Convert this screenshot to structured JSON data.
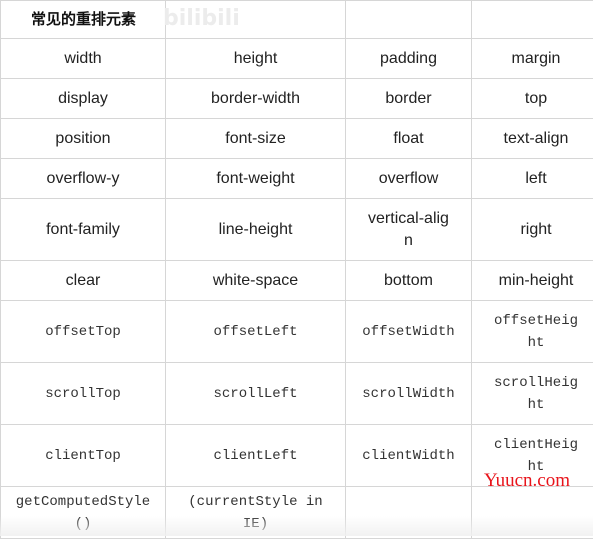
{
  "header": {
    "title": "常见的重排元素",
    "watermark": "bilibili"
  },
  "rows": [
    [
      "width",
      "height",
      "padding",
      "margin"
    ],
    [
      "display",
      "border-width",
      "border",
      "top"
    ],
    [
      "position",
      "font-size",
      "float",
      "text-align"
    ],
    [
      "overflow-y",
      "font-weight",
      "overflow",
      "left"
    ],
    [
      "font-family",
      "line-height",
      "vertical-align",
      "right"
    ],
    [
      "clear",
      "white-space",
      "bottom",
      "min-height"
    ],
    [
      "offsetTop",
      "offsetLeft",
      "offsetWidth",
      "offsetHeight"
    ],
    [
      "scrollTop",
      "scrollLeft",
      "scrollWidth",
      "scrollHeight"
    ],
    [
      "clientTop",
      "clientLeft",
      "clientWidth",
      "clientHeight"
    ],
    [
      "getComputedStyle()",
      "(currentStyle in IE)",
      "",
      ""
    ]
  ],
  "site_watermark": "Yuucn.com",
  "colors": {
    "border": "#d6d6d6",
    "site_watermark": "#e8141b"
  }
}
